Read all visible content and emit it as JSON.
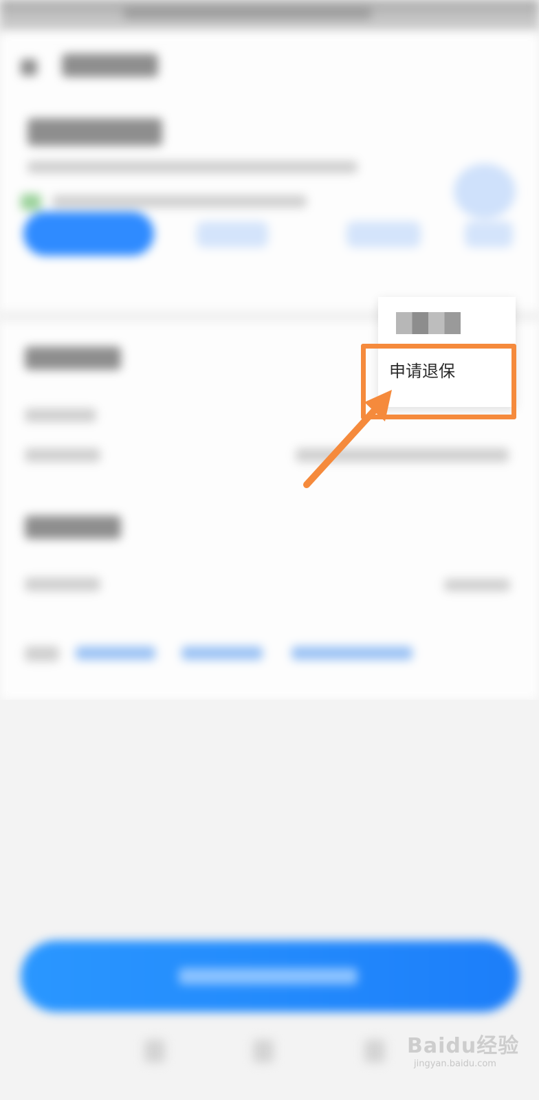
{
  "menu": {
    "item_2_label": "申请退保"
  },
  "watermark": {
    "logo_text": "Baidu经验",
    "sub_text": "jingyan.baidu.com"
  },
  "colors": {
    "annotation": "#f58a3c",
    "accent_blue": "#2f8bff"
  },
  "icons": {
    "back": "back-arrow-icon"
  }
}
